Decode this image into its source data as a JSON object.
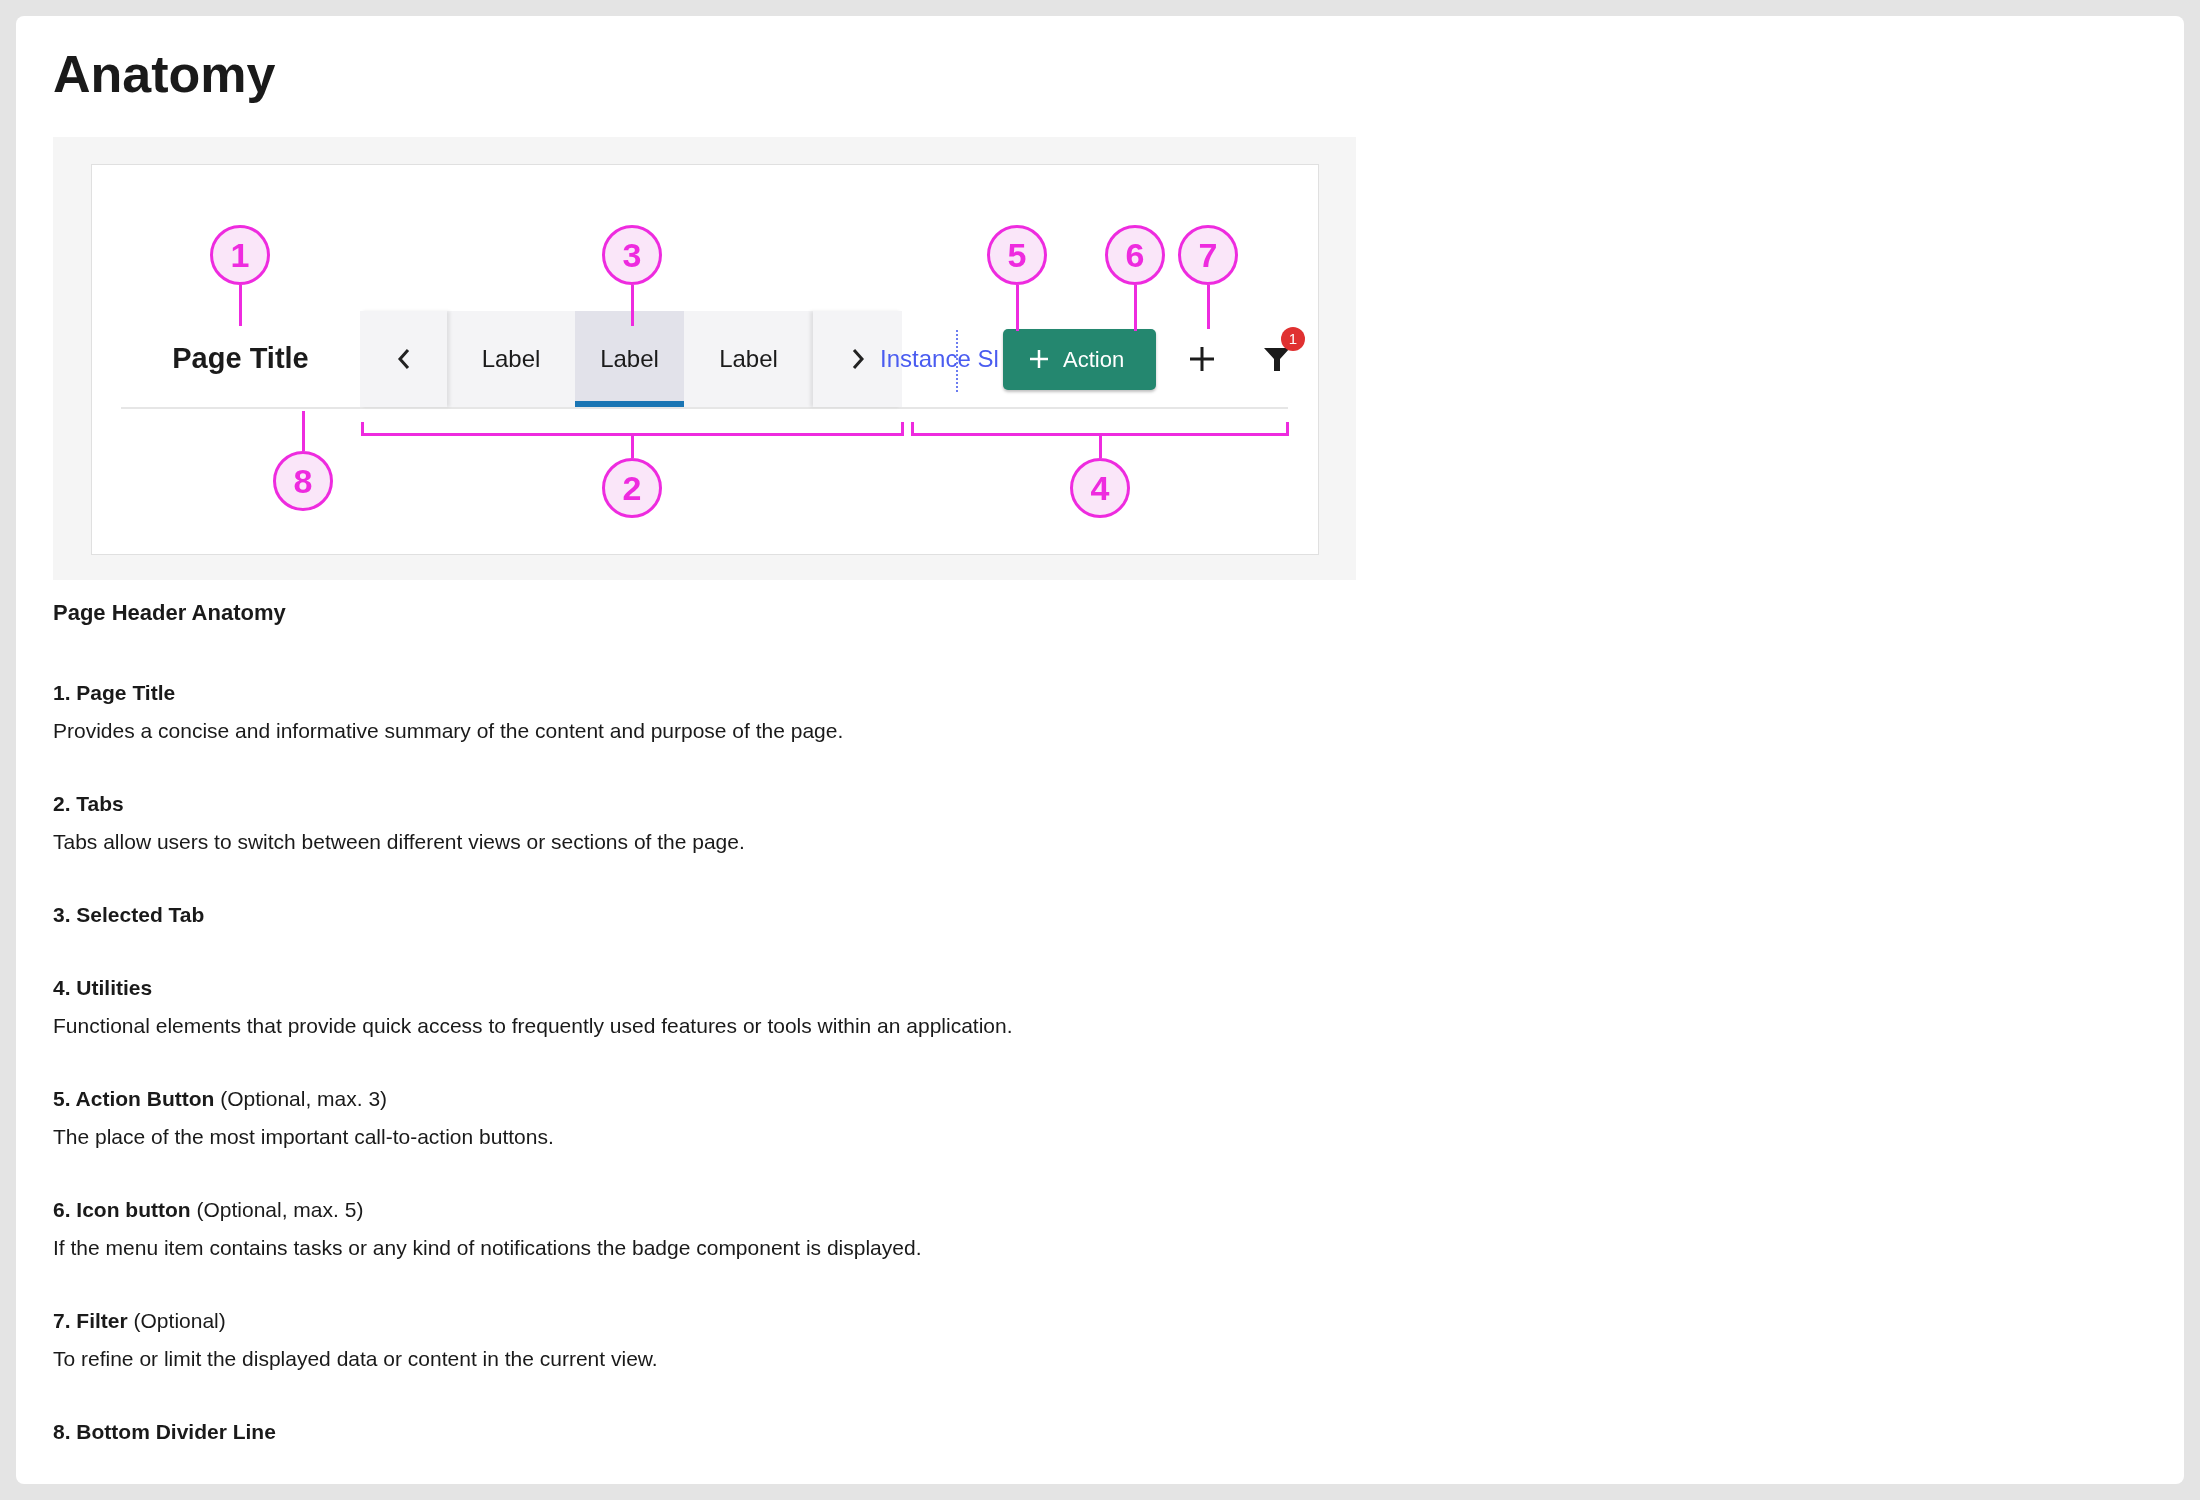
{
  "heading": "Anatomy",
  "diagram": {
    "page_title": "Page Title",
    "tabs": [
      {
        "label": "Label",
        "selected": false
      },
      {
        "label": "Label",
        "selected": true
      },
      {
        "label": "Label",
        "selected": false
      }
    ],
    "overflow_text": "Instance Sl",
    "action_button": "Action",
    "filter_badge": "1",
    "callouts": [
      {
        "number": "1"
      },
      {
        "number": "3"
      },
      {
        "number": "5"
      },
      {
        "number": "6"
      },
      {
        "number": "7"
      },
      {
        "number": "8"
      },
      {
        "number": "2"
      },
      {
        "number": "4"
      }
    ]
  },
  "caption": "Page Header Anatomy",
  "sections": [
    {
      "title": "1. Page Title",
      "description": "Provides a concise and informative summary of the content and purpose of the page."
    },
    {
      "title": "2. Tabs",
      "description": "Tabs allow users to switch between different views or sections of the page."
    },
    {
      "title": "3. Selected Tab"
    },
    {
      "title": "4. Utilities",
      "description": "Functional elements that provide quick access to frequently used features or tools within an application."
    },
    {
      "title": "5. Action Button",
      "note": "(Optional, max. 3)",
      "description": "The place of the most important call-to-action buttons."
    },
    {
      "title": "6. Icon button",
      "note": "(Optional, max. 5)",
      "description": "If the menu item contains tasks or any kind of notifications the badge component is displayed."
    },
    {
      "title": "7. Filter",
      "note": "(Optional)",
      "description": "To refine or limit the displayed data or content in the current view."
    },
    {
      "title": "8. Bottom Divider Line"
    }
  ]
}
